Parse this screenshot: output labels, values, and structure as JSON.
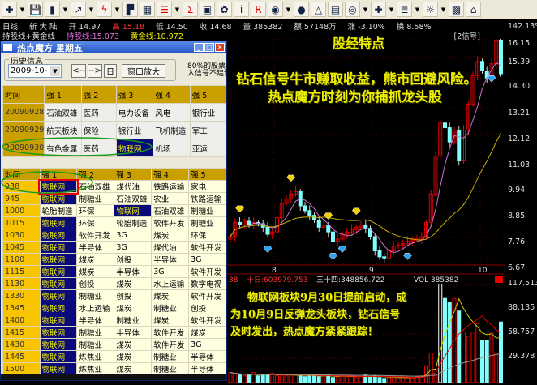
{
  "toolbar": {
    "icons": [
      "crosshair-icon",
      "save-icon",
      "candlestick-icon",
      "line-chart-icon",
      "lightning-icon",
      "pistol-icon",
      "grid-icon",
      "table-icon",
      "sigma-icon",
      "book-icon",
      "medal-icon",
      "info-icon",
      "rsi-icon",
      "eye-icon",
      "coin-icon",
      "triangle-icon",
      "ticket-icon",
      "cycle-icon",
      "plus-icon",
      "stack-icon",
      "sun-icon",
      "color-blocks-icon",
      "home-icon"
    ]
  },
  "info": {
    "period": "日线",
    "name": "新 大 陆",
    "open_label": "开",
    "open": "14.97",
    "high_label": "高",
    "high": "15.18",
    "low_label": "低",
    "low": "14.50",
    "close_label": "收",
    "close": "14.68",
    "vol_label": "量",
    "vol": "385382",
    "amt_label": "额",
    "amt": "57148万",
    "chg_label": "涨",
    "chg": "-3.10%",
    "turn_label": "换",
    "turn": "8.58%"
  },
  "indicator": {
    "name": "持股线+黄金线",
    "hold_label": "持股线:15.073",
    "gold_label": "黄金线:10.972",
    "signal": "[2信号]"
  },
  "axis": {
    "top_pct": "142.13%",
    "price_ticks": [
      "16.15",
      "15.39",
      "14.30",
      "13.21",
      "12.12",
      "11.03",
      "9.94",
      "8.85",
      "7.76",
      "6.67"
    ],
    "vol_ticks": [
      "117.513",
      "88.135",
      "58.757",
      "29.378"
    ],
    "dates": [
      "8",
      "9",
      "10"
    ]
  },
  "volume_info": {
    "left": "38",
    "ma10": "十日:603979.753",
    "ma34": "三十四:348856.722",
    "vol": "VOL 385382"
  },
  "overlay": {
    "title": "股经特点",
    "line1": "钻石信号牛市赚取收益，熊市回避风险。",
    "line2": "热点魔方时刻为你捕抓龙头股",
    "vol1": "物联网板块9月30日提前启动，成",
    "vol2": "为10月9日反弹龙头板块，钻石信号",
    "vol3": "及时发出，热点魔方紧紧跟踪！"
  },
  "window": {
    "title": "热点魔方  星期五",
    "group": "历史信息",
    "date": "2009-10- 9",
    "prev": "<--",
    "next": "-->",
    "day": "日",
    "zoom": "窗口放大",
    "note1": "80%的股票跟",
    "note2": "入信号不建议",
    "headers": [
      "时间",
      "强 1",
      "强 2",
      "强 3",
      "强 4",
      "强 5"
    ],
    "history": [
      [
        "20090928",
        "石油双雄",
        "医药",
        "电力设备",
        "风电",
        "银行业"
      ],
      [
        "20090929",
        "航天板块",
        "保险",
        "银行业",
        "飞机制造",
        "军工"
      ],
      [
        "20090930",
        "有色金属",
        "医药",
        "物联网",
        "机场",
        "亚运"
      ]
    ],
    "intraday": [
      [
        "938",
        "物联网",
        "石油双雄",
        "煤代油",
        "铁路运输",
        "家电"
      ],
      [
        "945",
        "物联网",
        "制糖业",
        "石油双雄",
        "农业",
        "铁路运输"
      ],
      [
        "1000",
        "轮胎制造",
        "环保",
        "物联网",
        "石油双雄",
        "制糖业"
      ],
      [
        "1015",
        "物联网",
        "环保",
        "轮胎制造",
        "软件开发",
        "制糖业"
      ],
      [
        "1030",
        "物联网",
        "软件开发",
        "3G",
        "煤炭",
        "环保"
      ],
      [
        "1045",
        "物联网",
        "半导体",
        "3G",
        "煤代油",
        "软件开发"
      ],
      [
        "1100",
        "物联网",
        "煤炭",
        "创投",
        "半导体",
        "3G"
      ],
      [
        "1115",
        "物联网",
        "煤炭",
        "半导体",
        "3G",
        "软件开发"
      ],
      [
        "1130",
        "物联网",
        "创投",
        "煤炭",
        "水上运输",
        "数字电视"
      ],
      [
        "1330",
        "物联网",
        "制糖业",
        "创投",
        "煤炭",
        "软件开发"
      ],
      [
        "1345",
        "物联网",
        "水上运输",
        "煤炭",
        "制糖业",
        "创投"
      ],
      [
        "1400",
        "物联网",
        "半导体",
        "制糖业",
        "煤炭",
        "软件开发"
      ],
      [
        "1415",
        "物联网",
        "制糖业",
        "半导体",
        "软件开发",
        "煤炭"
      ],
      [
        "1430",
        "物联网",
        "制糖业",
        "煤炭",
        "软件开发",
        "3G"
      ],
      [
        "1445",
        "物联网",
        "炼焦业",
        "煤炭",
        "制糖业",
        "半导体"
      ],
      [
        "1500",
        "物联网",
        "炼焦业",
        "煤炭",
        "制糖业",
        "半导体"
      ]
    ],
    "highlight": "物联网"
  },
  "chart_data": {
    "type": "candlestick",
    "ylim": [
      6.67,
      16.15
    ],
    "vol_ylim": [
      0,
      117.513
    ],
    "closes": [
      7.8,
      8.4,
      8.3,
      8.45,
      8.3,
      8.4,
      8.35,
      8.2,
      7.9,
      8.0,
      8.6,
      9.2,
      9.4,
      9.6,
      9.7,
      9.1,
      8.9,
      8.7,
      8.5,
      8.2,
      8.3,
      8.0,
      7.6,
      7.7,
      7.9,
      8.0,
      8.1,
      8.2,
      8.3,
      8.15,
      7.8,
      7.2,
      6.95,
      6.9,
      7.2,
      7.4,
      7.45,
      7.5,
      7.6,
      7.7,
      7.7,
      7.8,
      8.4,
      9.6,
      11.2,
      12.6,
      12.4,
      11.8,
      12.3,
      11.0,
      12.3,
      13.4,
      14.6,
      15.2,
      14.8,
      14.5,
      15.1,
      16.1,
      14.68
    ],
    "volumes": [
      12,
      10,
      9,
      8,
      10,
      12,
      8,
      9,
      10,
      11,
      8,
      9,
      8,
      9,
      10,
      8,
      7,
      9,
      8,
      7,
      8,
      9,
      6,
      7,
      8,
      7,
      8,
      6,
      7,
      9,
      7,
      8,
      6,
      5,
      6,
      7,
      6,
      6,
      5,
      6,
      7,
      8,
      20,
      35,
      10,
      117,
      100,
      95,
      100,
      85,
      60,
      55,
      60,
      70,
      50,
      50,
      60,
      35,
      72
    ],
    "gold_signals": [
      2,
      13,
      21,
      27
    ],
    "blue_signals": [
      8,
      22,
      24,
      38,
      56
    ],
    "colors": {
      "up": "#e00000",
      "down": "#80ffff",
      "ma_short": "#d070d0",
      "ma_long": "#c8b000"
    }
  }
}
